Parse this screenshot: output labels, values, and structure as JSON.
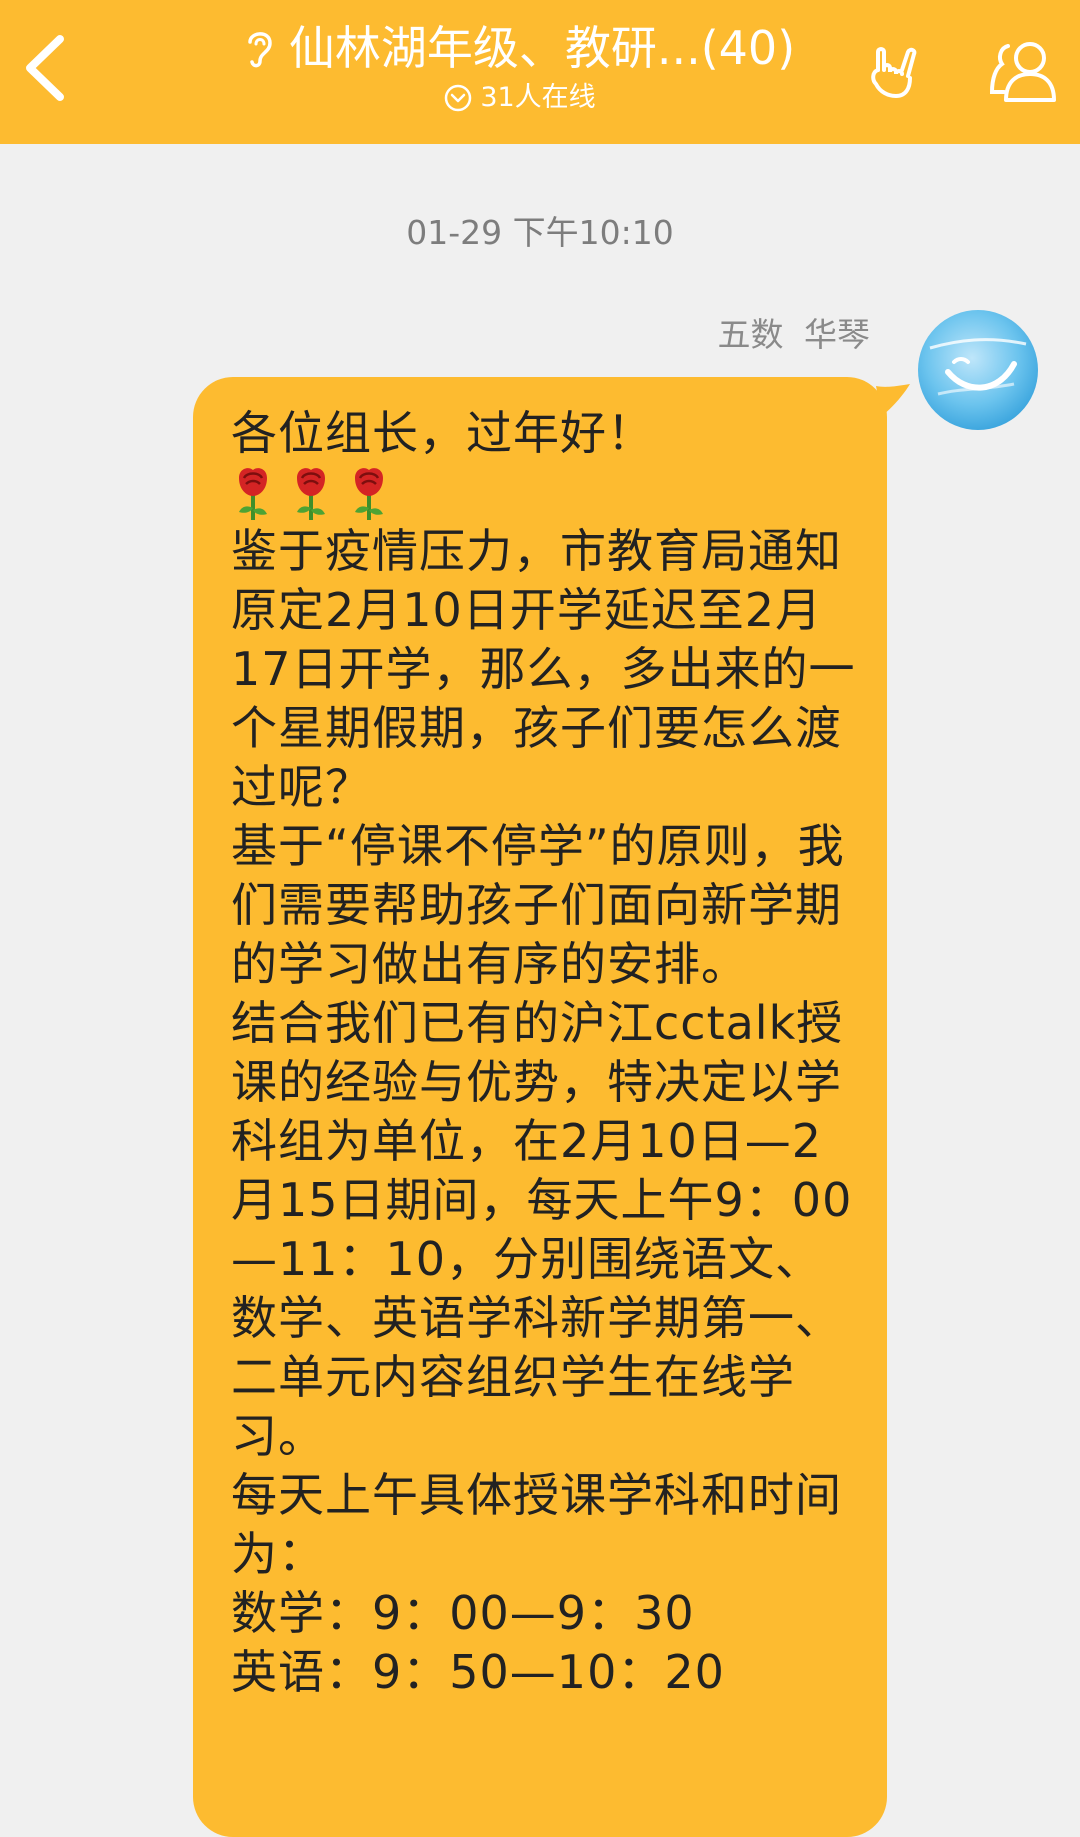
{
  "header": {
    "title": "仙林湖年级、教研...(40)",
    "online": "31人在线",
    "bg_color": "#fdbb30",
    "icons": [
      "back-icon",
      "ear-icon",
      "chevron-down-circle-icon",
      "hand-gesture-icon",
      "group-members-icon"
    ]
  },
  "chat": {
    "timestamp": "01-29 下午10:10",
    "message": {
      "sender": "五数 华琴",
      "bubble_color": "#fdbb30",
      "lines": [
        "各位组长，过年好！",
        "鉴于疫情压力，市教育局通知原定2月10日开学延迟至2月17日开学，那么，多出来的一个星期假期，孩子们要怎么渡过呢？",
        "基于“停课不停学”的原则，我们需要帮助孩子们面向新学期的学习做出有序的安排。",
        "结合我们已有的沪江cctalk授课的经验与优势，特决定以学科组为单位，在2月10日—2月15日期间，每天上午9：00—11：10，分别围绕语文、数学、英语学科新学期第一、二单元内容组织学生在线学习。",
        "每天上午具体授课学科和时间为：",
        "数学：9：00—9：30",
        "英语：9：50—10：20"
      ],
      "emoji": [
        "rose-icon",
        "rose-icon",
        "rose-icon"
      ]
    }
  }
}
